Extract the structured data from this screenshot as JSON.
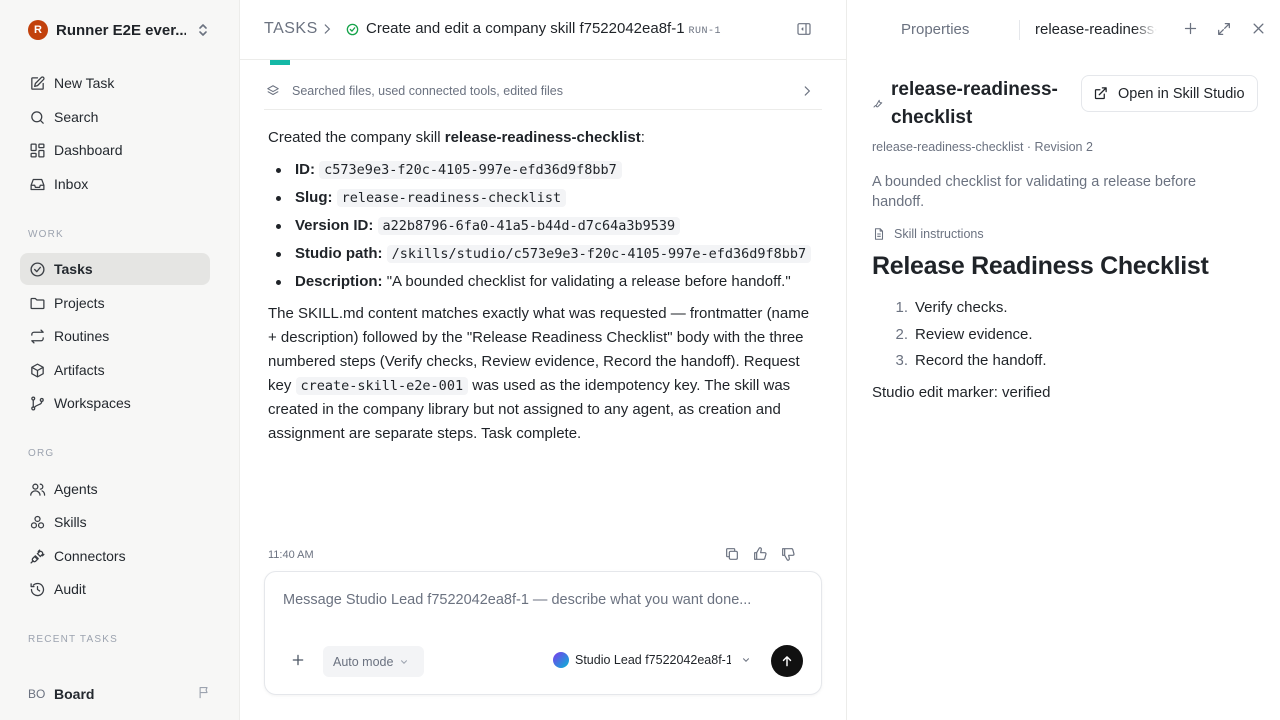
{
  "sidebar": {
    "workspace": {
      "initial": "R",
      "name": "Runner E2E ever..."
    },
    "top_items": [
      {
        "label": "New Task",
        "icon": "edit-icon"
      },
      {
        "label": "Search",
        "icon": "search-icon"
      },
      {
        "label": "Dashboard",
        "icon": "dashboard-icon"
      },
      {
        "label": "Inbox",
        "icon": "inbox-icon"
      }
    ],
    "work_label": "WORK",
    "work_items": [
      {
        "label": "Tasks",
        "icon": "check-circle-icon",
        "active": true
      },
      {
        "label": "Projects",
        "icon": "folder-icon"
      },
      {
        "label": "Routines",
        "icon": "repeat-icon"
      },
      {
        "label": "Artifacts",
        "icon": "package-icon"
      },
      {
        "label": "Workspaces",
        "icon": "branch-icon"
      }
    ],
    "org_label": "ORG",
    "org_items": [
      {
        "label": "Agents",
        "icon": "users-icon"
      },
      {
        "label": "Skills",
        "icon": "skills-icon"
      },
      {
        "label": "Connectors",
        "icon": "plug-icon"
      },
      {
        "label": "Audit",
        "icon": "history-icon"
      }
    ],
    "recent_label": "RECENT TASKS",
    "board": {
      "initials": "BO",
      "label": "Board"
    }
  },
  "header": {
    "root": "TASKS",
    "title": "Create and edit a company skill f7522042ea8f-1",
    "run_tag": "RUN-1"
  },
  "tools_summary": "Searched files, used connected tools, edited files",
  "message": {
    "intro_prefix": "Created the company skill ",
    "intro_skill": "release-readiness-checklist",
    "intro_suffix": ":",
    "fields": {
      "id_label": "ID:",
      "id_value": "c573e9e3-f20c-4105-997e-efd36d9f8bb7",
      "slug_label": "Slug:",
      "slug_value": "release-readiness-checklist",
      "version_label": "Version ID:",
      "version_value": "a22b8796-6fa0-41a5-b44d-d7c64a3b9539",
      "path_label": "Studio path:",
      "path_value": "/skills/studio/c573e9e3-f20c-4105-997e-efd36d9f8bb7",
      "desc_label": "Description:",
      "desc_value": "\"A bounded checklist for validating a release before handoff.\""
    },
    "body_part1": "The SKILL.md content matches exactly what was requested — frontmatter (name + description) followed by the \"Release Readiness Checklist\" body with the three numbered steps (Verify checks, Review evidence, Record the handoff). Request key ",
    "body_code": "create-skill-e2e-001",
    "body_part2": " was used as the idempotency key. The skill was created in the company library but not assigned to any agent, as creation and assignment are separate steps. Task complete.",
    "timestamp": "11:40 AM"
  },
  "composer": {
    "placeholder": "Message Studio Lead f7522042ea8f-1 — describe what you want done...",
    "mode": "Auto mode",
    "agent": "Studio Lead f7522042ea8f-1"
  },
  "right_panel": {
    "tab_properties": "Properties",
    "tab_file": "release-readiness-checklist",
    "skill_title": "release-readiness-checklist",
    "open_button": "Open in Skill Studio",
    "subtitle": "release-readiness-checklist · Revision 2",
    "description": "A bounded checklist for validating a release before handoff.",
    "instructions_label": "Skill instructions",
    "doc_title": "Release Readiness Checklist",
    "steps": [
      {
        "n": "1.",
        "text": "Verify checks."
      },
      {
        "n": "2.",
        "text": "Review evidence."
      },
      {
        "n": "3.",
        "text": "Record the handoff."
      }
    ],
    "marker": "Studio edit marker: verified"
  },
  "colors": {
    "brand": "#c2410c",
    "status_green": "#16a34a",
    "accent_teal": "#14b8a6",
    "send_button": "#111111"
  }
}
